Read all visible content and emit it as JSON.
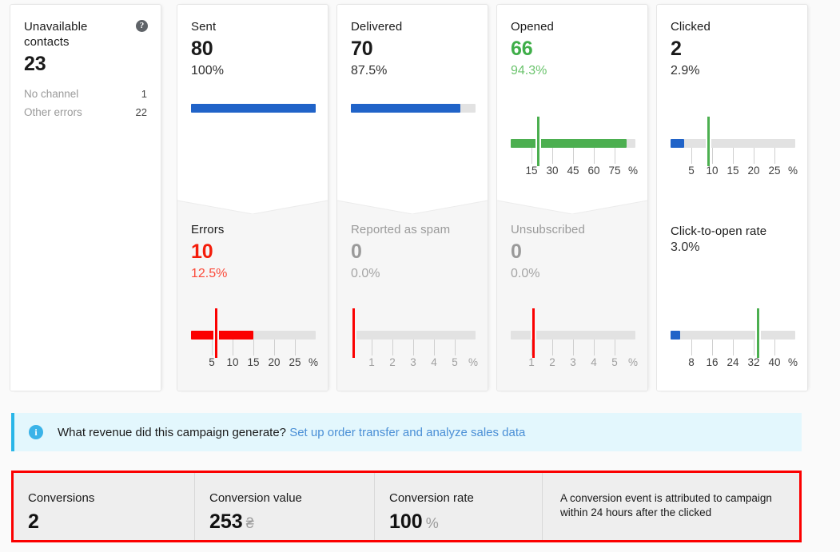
{
  "cards": [
    {
      "id": "unavailable-contacts",
      "label": "Unavailable contacts",
      "value": "23",
      "help_icon": "?",
      "rows": [
        {
          "label": "No channel",
          "value": "1"
        },
        {
          "label": "Other errors",
          "value": "22"
        }
      ]
    },
    {
      "id": "sent",
      "label": "Sent",
      "value": "80",
      "percent": "100%",
      "bar": {
        "color": "#2063c8",
        "fill_pct": 100,
        "marker": null,
        "scale": null
      }
    },
    {
      "id": "delivered",
      "label": "Delivered",
      "value": "70",
      "percent": "87.5%",
      "bar": {
        "color": "#2063c8",
        "fill_pct": 87.5,
        "marker": null,
        "scale": null
      }
    },
    {
      "id": "opened",
      "label": "Opened",
      "value": "66",
      "percent": "94.3%",
      "bar": {
        "color": "#4caf50",
        "fill_pct": 93,
        "marker": {
          "pos_pct": 22,
          "color": "#4caf50"
        },
        "scale": {
          "ticks": [
            "15",
            "30",
            "45",
            "60",
            "75"
          ],
          "unit": "%"
        }
      }
    },
    {
      "id": "clicked",
      "label": "Clicked",
      "value": "2",
      "percent": "2.9%",
      "bar": {
        "color": "#2063c8",
        "fill_pct": 11,
        "marker": {
          "pos_pct": 30,
          "color": "#4caf50"
        },
        "scale": {
          "ticks": [
            "5",
            "10",
            "15",
            "20",
            "25"
          ],
          "unit": "%"
        }
      }
    }
  ],
  "lower_cards": [
    {
      "id": "errors",
      "label": "Errors",
      "value": "10",
      "percent": "12.5%",
      "value_color": "red",
      "bar": {
        "color": "#fb0000",
        "fill_pct": 50,
        "marker": {
          "pos_pct": 20,
          "color": "#fb0000"
        },
        "scale": {
          "ticks": [
            "5",
            "10",
            "15",
            "20",
            "25"
          ],
          "unit": "%"
        }
      }
    },
    {
      "id": "reported-as-spam",
      "label": "Reported as spam",
      "value": "0",
      "percent": "0.0%",
      "value_color": "muted",
      "muted": true,
      "bar": {
        "color": "#c9c9c9",
        "fill_pct": 2,
        "marker": {
          "pos_pct": 2,
          "color": "#fb0000"
        },
        "scale": {
          "ticks": [
            "1",
            "2",
            "3",
            "4",
            "5"
          ],
          "unit": "%"
        }
      }
    },
    {
      "id": "unsubscribed",
      "label": "Unsubscribed",
      "value": "0",
      "percent": "0.0%",
      "value_color": "muted",
      "muted": true,
      "bar": {
        "color": "#e2e2e2",
        "fill_pct": 0,
        "marker": {
          "pos_pct": 18,
          "color": "#fb0000"
        },
        "scale": {
          "ticks": [
            "1",
            "2",
            "3",
            "4",
            "5"
          ],
          "unit": "%"
        }
      }
    },
    {
      "id": "click-to-open-rate",
      "label": "Click-to-open rate",
      "value": "3.0%",
      "plain": true,
      "bar": {
        "color": "#2063c8",
        "fill_pct": 8,
        "marker": {
          "pos_pct": 70,
          "color": "#4caf50"
        },
        "scale": {
          "ticks": [
            "8",
            "16",
            "24",
            "32",
            "40"
          ],
          "unit": "%"
        }
      }
    }
  ],
  "info_banner": {
    "icon": "info-icon",
    "text": "What revenue did this campaign generate?",
    "link": "Set up order transfer and analyze sales data"
  },
  "conversions": {
    "cells": [
      {
        "label": "Conversions",
        "value": "2",
        "unit": ""
      },
      {
        "label": "Conversion value",
        "value": "253",
        "unit": "₴"
      },
      {
        "label": "Conversion rate",
        "value": "100",
        "unit": "%"
      }
    ],
    "note": "A conversion event is attributed to campaign within 24 hours after the clicked"
  },
  "colors": {
    "blue": "#2063c8",
    "green": "#4caf50",
    "red": "#fb0000",
    "highlight": "#fb0000",
    "info_bg": "#e3f7fd",
    "info_border": "#29b6e8"
  }
}
